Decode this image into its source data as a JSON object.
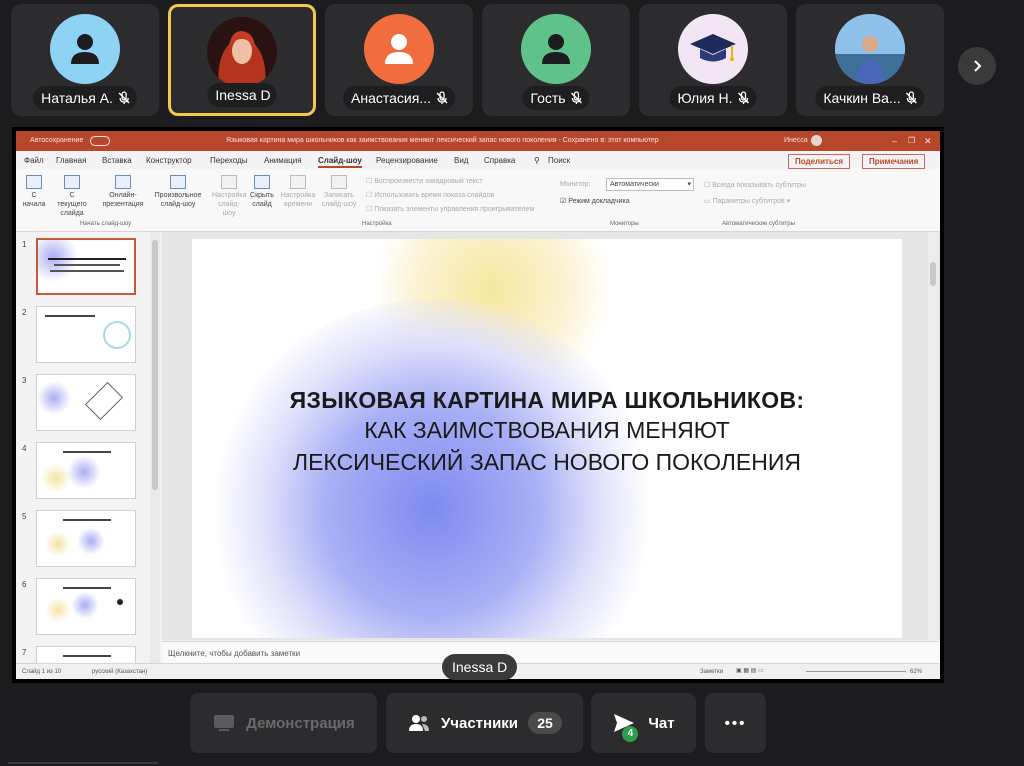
{
  "participants": [
    {
      "name": "Наталья А.",
      "avatar": "person-icon",
      "color": "#8fd3f4"
    },
    {
      "name": "Inessa D",
      "avatar": "photo",
      "active": true
    },
    {
      "name": "Анастасия...",
      "avatar": "person-icon",
      "color": "#f26d3d"
    },
    {
      "name": "Гость",
      "avatar": "person-icon",
      "color": "#5fc28a"
    },
    {
      "name": "Юлия Н.",
      "avatar": "graduation-cap-icon",
      "color": "#f3e6f4"
    },
    {
      "name": "Качкин Ва...",
      "avatar": "photo"
    }
  ],
  "ppt": {
    "autosave": "Автосохранение",
    "doc_title": "Языковая картина мира школьников как заимствования меняют лексический запас нового поколения - Сохранено в: этот компьютер",
    "user": "Инесса",
    "tabs": [
      "Файл",
      "Главная",
      "Вставка",
      "Конструктор",
      "Переходы",
      "Анимация",
      "Слайд-шоу",
      "Рецензирование",
      "Вид",
      "Справка",
      "Поиск"
    ],
    "share": "Поделиться",
    "comments": "Примечания",
    "ribbon": {
      "from_start": "С начала",
      "from_current": "С текущего слайда",
      "online": "Онлайн-презентация",
      "custom": "Произвольное слайд-шоу",
      "group_start": "Начать слайд-шоу",
      "setup": "Настройка слайд-шоу",
      "hide": "Скрыть слайд",
      "rehearse": "Настройка времени",
      "record": "Записать слайд-шоу",
      "cb1": "Воспроизвести закадровый текст",
      "cb2": "Использовать время показа слайдов",
      "cb3": "Показать элементы управления проигрывателем",
      "group_setup": "Настройка",
      "monitor_label": "Монитор:",
      "monitor_value": "Автоматически",
      "presenter": "Режим докладчика",
      "group_monitors": "Мониторы",
      "subs_always": "Всегда показывать субтитры",
      "subs_params": "Параметры субтитров",
      "group_subs": "Автоматические субтитры"
    },
    "slide": {
      "line1": "ЯЗЫКОВАЯ КАРТИНА МИРА ШКОЛЬНИКОВ:",
      "line2": "КАК ЗАИМСТВОВАНИЯ МЕНЯЮТ",
      "line3": "ЛЕКСИЧЕСКИЙ ЗАПАС НОВОГО ПОКОЛЕНИЯ"
    },
    "thumb_numbers": [
      "1",
      "2",
      "3",
      "4",
      "5",
      "6",
      "7"
    ],
    "notes_placeholder": "Щелкните, чтобы добавить заметки",
    "status_slide": "Слайд 1 из 10",
    "status_lang": "русский (Казахстан)",
    "status_notes": "Заметки",
    "zoom": "62%"
  },
  "speaker_label": "Inessa D",
  "controls": {
    "demo": "Демонстрация",
    "participants": "Участники",
    "participants_count": "25",
    "chat": "Чат",
    "chat_count": "4",
    "more": "•••"
  }
}
